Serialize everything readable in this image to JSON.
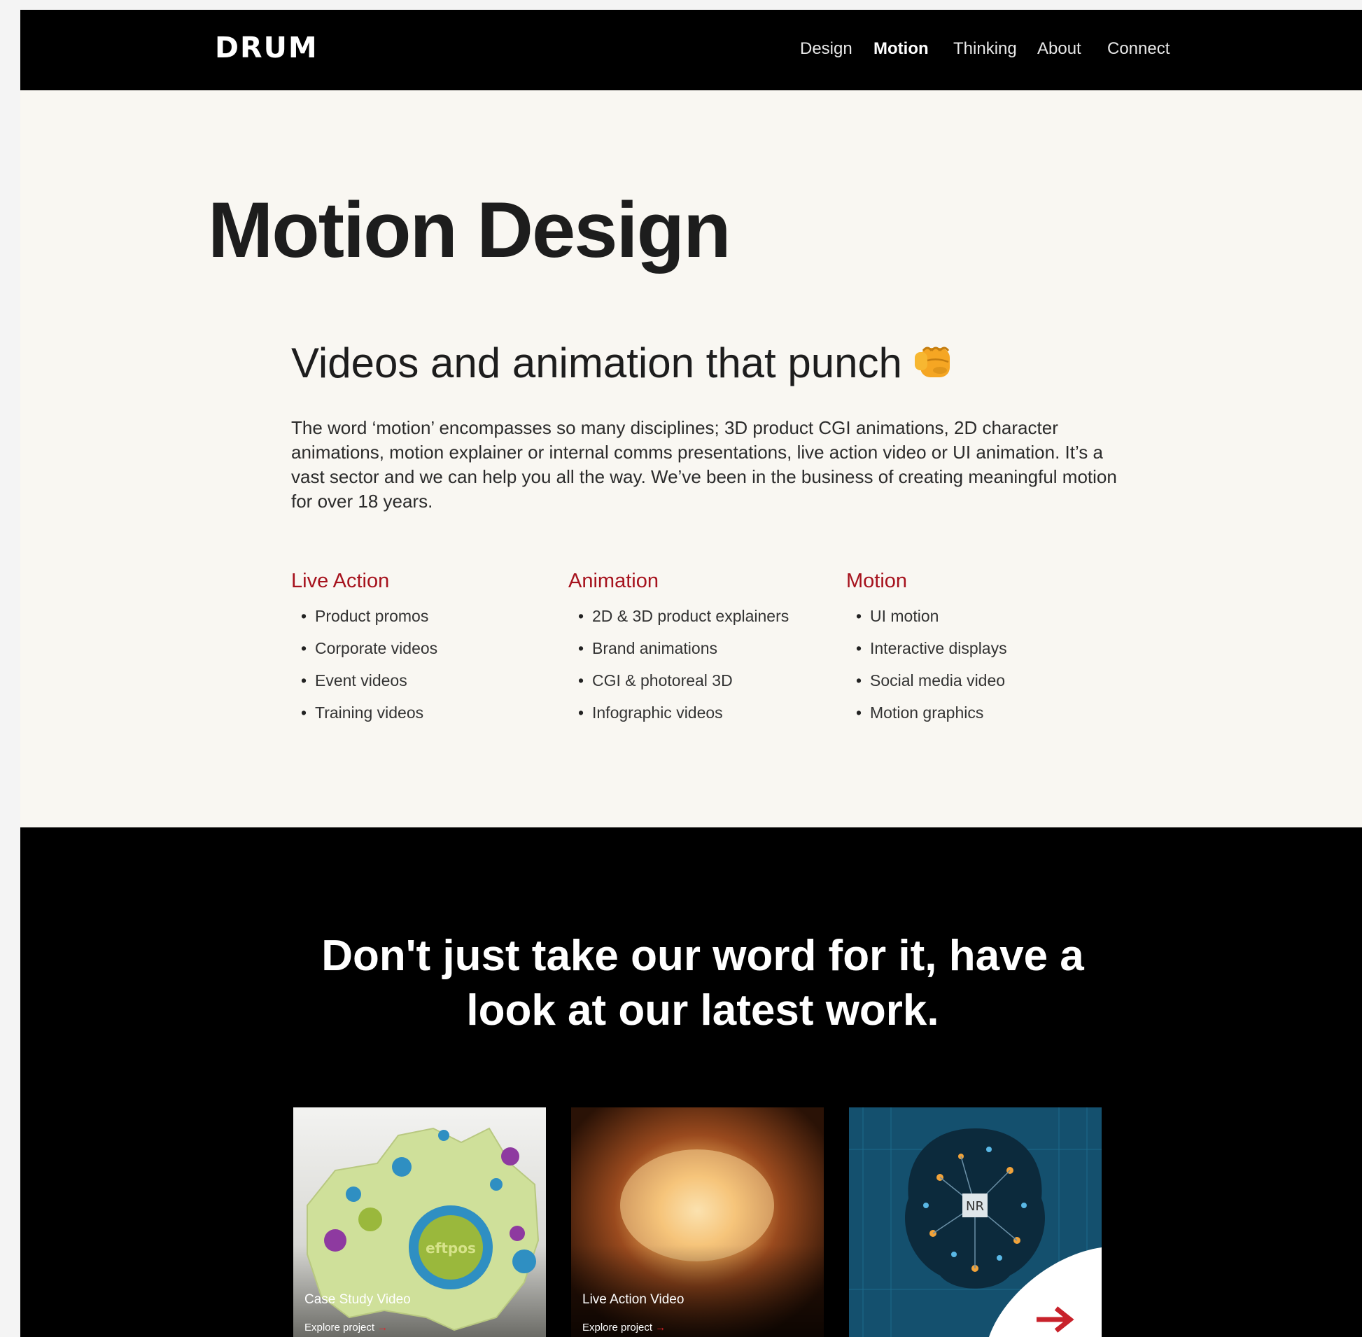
{
  "header": {
    "logo": "DRUM",
    "nav": [
      {
        "label": "Design"
      },
      {
        "label": "Motion",
        "active": true
      },
      {
        "label": "Thinking"
      },
      {
        "label": "About"
      },
      {
        "label": "Connect"
      }
    ]
  },
  "hero": {
    "title": "Motion Design",
    "subtitle": "Videos and animation that punch",
    "subtitle_icon": "fist-punch-icon",
    "intro": "The word ‘motion’ encompasses so many disciplines; 3D product CGI animations, 2D character animations, motion explainer or internal comms presentations, live action video or UI animation. It’s a vast sector and we can help you all the way. We’ve been in the business of creating meaningful motion for over 18 years."
  },
  "services": [
    {
      "heading": "Live Action",
      "items": [
        "Product promos",
        "Corporate videos",
        "Event videos",
        "Training videos"
      ]
    },
    {
      "heading": "Animation",
      "items": [
        "2D & 3D product explainers",
        "Brand animations",
        "CGI & photoreal 3D",
        "Infographic videos"
      ]
    },
    {
      "heading": "Motion",
      "items": [
        "UI motion",
        "Interactive displays",
        "Social media video",
        "Motion graphics"
      ]
    }
  ],
  "work": {
    "heading_line1": "Don't just take our word for it, have a",
    "heading_line2": "look at our latest work.",
    "cards": [
      {
        "label": "Case Study Video",
        "link": "Explore project",
        "image_text": "eftpos"
      },
      {
        "label": "Live Action Video",
        "link": "Explore project"
      },
      {
        "label": "",
        "link": "",
        "image_text": "NR"
      }
    ]
  },
  "colors": {
    "accent_red": "#a6121d",
    "background": "#f9f7f2",
    "dark": "#000000"
  }
}
